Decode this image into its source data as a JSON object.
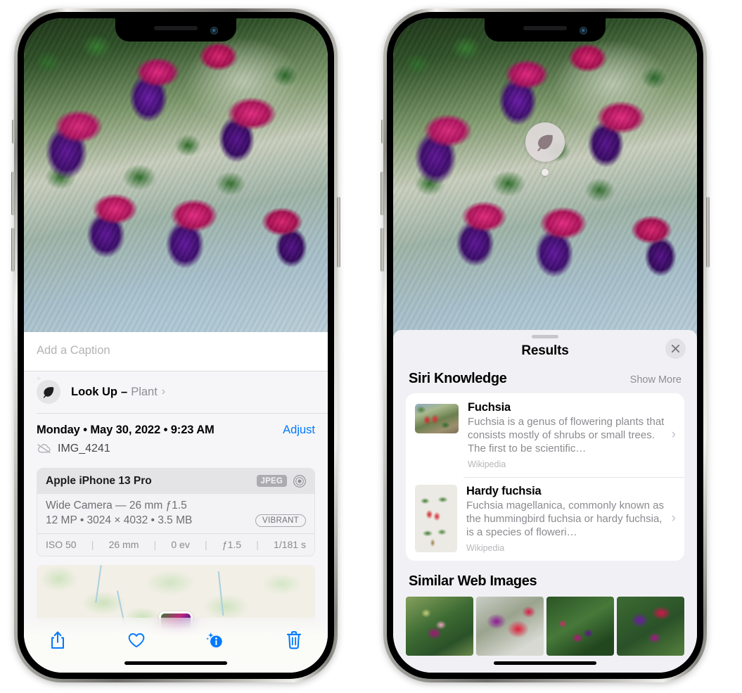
{
  "left_phone": {
    "caption": {
      "placeholder": "Add a Caption",
      "value": ""
    },
    "lookup": {
      "icon": "leaf-icon",
      "sparkle_icon": "sparkles-icon",
      "label": "Look Up",
      "dash": "–",
      "subject": "Plant",
      "chevron": "›"
    },
    "meta": {
      "date": "Monday • May 30, 2022 • 9:23 AM",
      "adjust_label": "Adjust",
      "cloud_icon": "cloud-slash-icon",
      "filename": "IMG_4241"
    },
    "camera_card": {
      "model": "Apple iPhone 13 Pro",
      "format_badge": "JPEG",
      "aperture_icon": "aperture-icon",
      "lens_line": "Wide Camera — 26 mm ƒ1.5",
      "specs_line": "12 MP • 3024 × 4032 • 3.5 MB",
      "style_badge": "VIBRANT",
      "exif": [
        "ISO 50",
        "26 mm",
        "0 ev",
        "ƒ1.5",
        "1/181 s"
      ],
      "separator": "|"
    },
    "toolbar": [
      {
        "name": "share-button",
        "icon": "share-icon"
      },
      {
        "name": "favorite-button",
        "icon": "heart-icon"
      },
      {
        "name": "info-button",
        "icon": "info-sparkle-icon"
      },
      {
        "name": "delete-button",
        "icon": "trash-icon"
      }
    ],
    "accent_color": "#007aff"
  },
  "right_phone": {
    "photo_badge": {
      "icon": "leaf-icon",
      "name": "visual-lookup-badge"
    },
    "sheet": {
      "title": "Results",
      "close_icon": "close-icon",
      "sections": [
        {
          "title": "Siri Knowledge",
          "action": "Show More",
          "items": [
            {
              "title": "Fuchsia",
              "description": "Fuchsia is a genus of flowering plants that consists mostly of shrubs or small trees. The first to be scientific…",
              "source": "Wikipedia",
              "chevron": "›"
            },
            {
              "title": "Hardy fuchsia",
              "description": "Fuchsia magellanica, commonly known as the hummingbird fuchsia or hardy fuchsia, is a species of floweri…",
              "source": "Wikipedia",
              "chevron": "›"
            }
          ]
        },
        {
          "title": "Similar Web Images",
          "images": [
            "web-image-1",
            "web-image-2",
            "web-image-3",
            "web-image-4"
          ]
        }
      ]
    }
  }
}
